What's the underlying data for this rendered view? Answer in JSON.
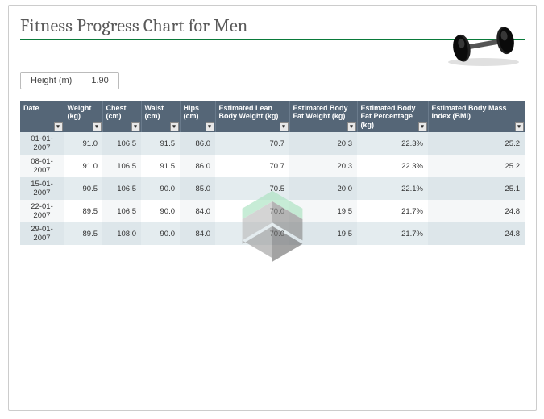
{
  "title": "Fitness Progress Chart for Men",
  "height_box": {
    "label": "Height (m)",
    "value": "1.90"
  },
  "columns": [
    "Date",
    "Weight (kg)",
    "Chest (cm)",
    "Waist (cm)",
    "Hips (cm)",
    "Estimated Lean Body Weight (kg)",
    "Estimated Body Fat Weight (kg)",
    "Estimated Body Fat Percentage (kg)",
    "Estimated Body Mass Index (BMI)"
  ],
  "col_widths": [
    "54",
    "48",
    "48",
    "48",
    "44",
    "92",
    "84",
    "88",
    "120"
  ],
  "rows": [
    {
      "date": "01-01-2007",
      "weight": "91.0",
      "chest": "106.5",
      "waist": "91.5",
      "hips": "86.0",
      "lean": "70.7",
      "fat_w": "20.3",
      "fat_pct": "22.3%",
      "bmi": "25.2"
    },
    {
      "date": "08-01-2007",
      "weight": "91.0",
      "chest": "106.5",
      "waist": "91.5",
      "hips": "86.0",
      "lean": "70.7",
      "fat_w": "20.3",
      "fat_pct": "22.3%",
      "bmi": "25.2"
    },
    {
      "date": "15-01-2007",
      "weight": "90.5",
      "chest": "106.5",
      "waist": "90.0",
      "hips": "85.0",
      "lean": "70.5",
      "fat_w": "20.0",
      "fat_pct": "22.1%",
      "bmi": "25.1"
    },
    {
      "date": "22-01-2007",
      "weight": "89.5",
      "chest": "106.5",
      "waist": "90.0",
      "hips": "84.0",
      "lean": "70.0",
      "fat_w": "19.5",
      "fat_pct": "21.7%",
      "bmi": "24.8"
    },
    {
      "date": "29-01-2007",
      "weight": "89.5",
      "chest": "108.0",
      "waist": "90.0",
      "hips": "84.0",
      "lean": "70.0",
      "fat_w": "19.5",
      "fat_pct": "21.7%",
      "bmi": "24.8"
    }
  ]
}
